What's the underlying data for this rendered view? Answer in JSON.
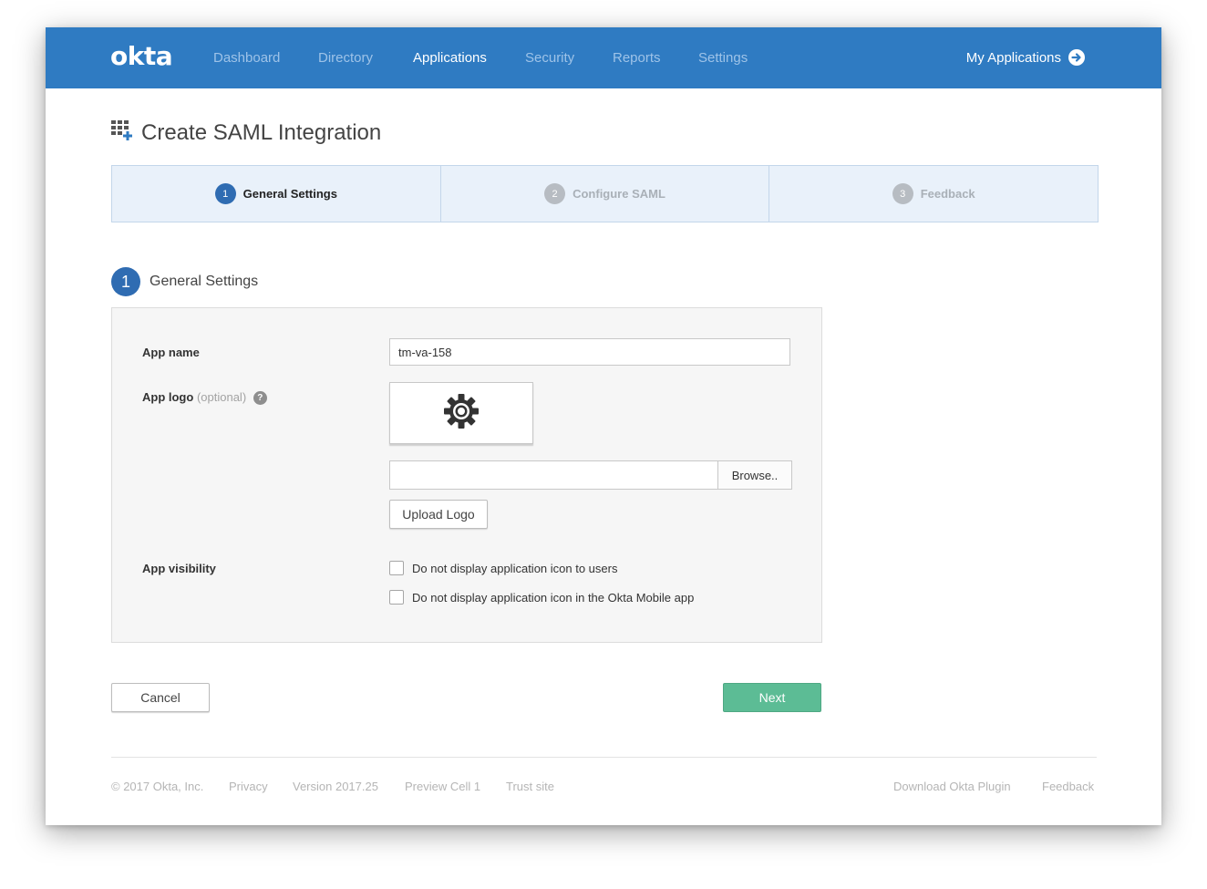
{
  "nav": {
    "logo": "okta",
    "items": [
      {
        "label": "Dashboard",
        "active": false
      },
      {
        "label": "Directory",
        "active": false
      },
      {
        "label": "Applications",
        "active": true
      },
      {
        "label": "Security",
        "active": false
      },
      {
        "label": "Reports",
        "active": false
      },
      {
        "label": "Settings",
        "active": false
      }
    ],
    "my_applications": "My Applications"
  },
  "page": {
    "title": "Create SAML Integration",
    "title_icon": "grid-plus-icon"
  },
  "wizard": {
    "steps": [
      {
        "num": "1",
        "label": "General Settings",
        "state": "active"
      },
      {
        "num": "2",
        "label": "Configure SAML",
        "state": "inactive"
      },
      {
        "num": "3",
        "label": "Feedback",
        "state": "inactive"
      }
    ]
  },
  "section": {
    "num": "1",
    "title": "General Settings"
  },
  "form": {
    "app_name_label": "App name",
    "app_name_value": "tm-va-158",
    "app_logo_label": "App logo",
    "app_logo_optional": "(optional)",
    "help_glyph": "?",
    "logo_placeholder_icon": "gear-icon",
    "browse_label": "Browse..",
    "upload_logo_label": "Upload Logo",
    "app_visibility_label": "App visibility",
    "checkbox_1": "Do not display application icon to users",
    "checkbox_2": "Do not display application icon in the Okta Mobile app"
  },
  "actions": {
    "cancel": "Cancel",
    "next": "Next"
  },
  "footer": {
    "copyright": "© 2017 Okta, Inc.",
    "privacy": "Privacy",
    "version": "Version 2017.25",
    "preview": "Preview Cell 1",
    "trust": "Trust site",
    "download_plugin": "Download Okta Plugin",
    "feedback": "Feedback"
  },
  "colors": {
    "nav_bg": "#2f7bc2",
    "step_active": "#2f6cb2",
    "next_button": "#5cbc95"
  }
}
